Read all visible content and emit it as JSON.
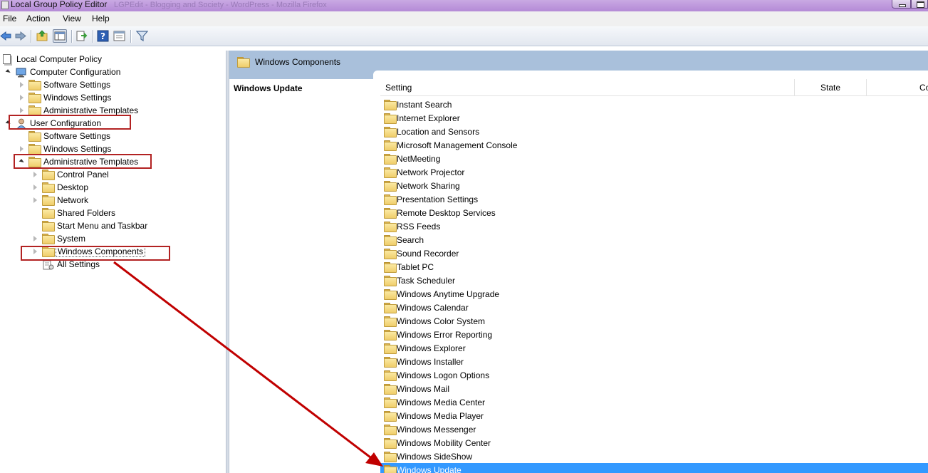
{
  "window": {
    "title": "Local Group Policy Editor",
    "ghost_title": "LGPEdit - Blogging and Society - WordPress - Mozilla Firefox"
  },
  "menu": [
    "File",
    "Action",
    "View",
    "Help"
  ],
  "toolbar": [
    "back-icon",
    "forward-icon",
    "up-folder-icon",
    "show-hide-tree-icon",
    "export-list-icon",
    "help-icon",
    "properties-view-icon",
    "filter-icon"
  ],
  "tree": {
    "root": "Local Computer Policy",
    "computer_configuration": "Computer Configuration",
    "cc_software_settings": "Software Settings",
    "cc_windows_settings": "Windows Settings",
    "cc_admin_templates": "Administrative Templates",
    "user_configuration": "User Configuration",
    "uc_software_settings": "Software Settings",
    "uc_windows_settings": "Windows Settings",
    "uc_admin_templates": "Administrative Templates",
    "control_panel": "Control Panel",
    "desktop": "Desktop",
    "network": "Network",
    "shared_folders": "Shared Folders",
    "start_menu": "Start Menu and Taskbar",
    "system": "System",
    "windows_components": "Windows Components",
    "all_settings": "All Settings"
  },
  "right": {
    "header": "Windows Components",
    "description_title": "Windows Update",
    "columns": [
      "Setting",
      "State",
      "Co"
    ],
    "items": [
      "Instant Search",
      "Internet Explorer",
      "Location and Sensors",
      "Microsoft Management Console",
      "NetMeeting",
      "Network Projector",
      "Network Sharing",
      "Presentation Settings",
      "Remote Desktop Services",
      "RSS Feeds",
      "Search",
      "Sound Recorder",
      "Tablet PC",
      "Task Scheduler",
      "Windows Anytime Upgrade",
      "Windows Calendar",
      "Windows Color System",
      "Windows Error Reporting",
      "Windows Explorer",
      "Windows Installer",
      "Windows Logon Options",
      "Windows Mail",
      "Windows Media Center",
      "Windows Media Player",
      "Windows Messenger",
      "Windows Mobility Center",
      "Windows SideShow",
      "Windows Update"
    ],
    "selected_item": "Windows Update"
  },
  "colors": {
    "highlight": "#3399ff",
    "annotation_red": "#b22222",
    "header_band": "#a9c0db"
  }
}
